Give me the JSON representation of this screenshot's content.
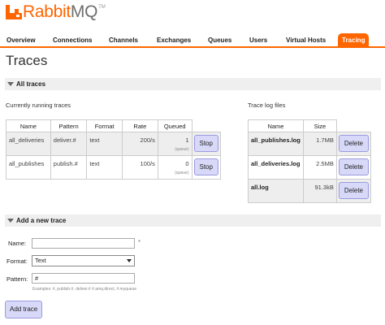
{
  "logo": {
    "brand": "Rabbit",
    "brand_suffix": "MQ",
    "tm": "TM"
  },
  "nav": [
    {
      "label": "Overview"
    },
    {
      "label": "Connections"
    },
    {
      "label": "Channels"
    },
    {
      "label": "Exchanges"
    },
    {
      "label": "Queues"
    },
    {
      "label": "Users"
    },
    {
      "label": "Virtual Hosts"
    },
    {
      "label": "Tracing"
    }
  ],
  "page_title": "Traces",
  "all_traces": {
    "heading": "All traces",
    "running_label": "Currently running traces",
    "columns": [
      "Name",
      "Pattern",
      "Format",
      "Rate",
      "Queued"
    ],
    "rows": [
      {
        "name": "all_deliveries",
        "pattern": "deliver.#",
        "format": "text",
        "rate": "200/s",
        "queued": "1",
        "queued_sub": "(queue)",
        "action": "Stop"
      },
      {
        "name": "all_publishes",
        "pattern": "publish.#",
        "format": "text",
        "rate": "100/s",
        "queued": "0",
        "queued_sub": "(queue)",
        "action": "Stop"
      }
    ],
    "log_label": "Trace log files",
    "log_columns": [
      "Name",
      "Size"
    ],
    "logs": [
      {
        "name": "all_publishes.log",
        "size": "1.7MB",
        "action": "Delete"
      },
      {
        "name": "all_deliveries.log",
        "size": "2.5MB",
        "action": "Delete"
      },
      {
        "name": "all.log",
        "size": "91.3kB",
        "action": "Delete"
      }
    ]
  },
  "add_trace": {
    "heading": "Add a new trace",
    "name_label": "Name:",
    "name_value": "",
    "required_mark": "*",
    "format_label": "Format:",
    "format_value": "Text",
    "pattern_label": "Pattern:",
    "pattern_value": "#",
    "hint": "Examples: #, publish.#, deliver.# #.amq.direct, #.myqueue",
    "submit": "Add trace"
  },
  "colors": {
    "accent": "#ff6600",
    "button": "#d8d8f8"
  }
}
